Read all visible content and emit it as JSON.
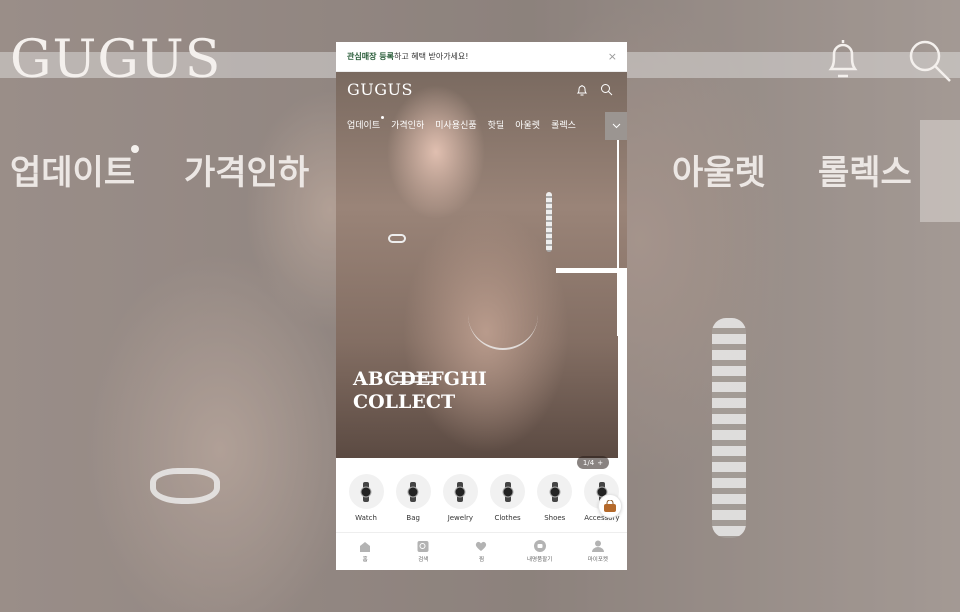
{
  "background": {
    "logo": "GUGUS",
    "nav": [
      "업데이트",
      "가격인하",
      "아울렛",
      "롤렉스"
    ]
  },
  "promo": {
    "highlight": "관심매장 등록",
    "text": "하고 혜택 받아가세요!",
    "close": "×"
  },
  "header": {
    "logo": "GUGUS"
  },
  "nav": {
    "items": [
      "업데이트",
      "가격인하",
      "미사용신품",
      "핫딜",
      "아울렛",
      "롤렉스"
    ]
  },
  "hero": {
    "title_line1": "ABCDEFGHI",
    "title_line2": "COLLECT",
    "subtitle": "구구스가 선택한 주얼리",
    "pager": "1/4",
    "pager_next": "+"
  },
  "categories": [
    {
      "label": "Watch"
    },
    {
      "label": "Bag"
    },
    {
      "label": "Jewelry"
    },
    {
      "label": "Clothes"
    },
    {
      "label": "Shoes"
    },
    {
      "label": "Accessory"
    }
  ],
  "tabbar": {
    "items": [
      {
        "label": "홈",
        "icon": "home-icon"
      },
      {
        "label": "검색",
        "icon": "search-icon"
      },
      {
        "label": "찜",
        "icon": "heart-icon"
      },
      {
        "label": "내명품팔기",
        "icon": "sell-icon"
      },
      {
        "label": "마이포켓",
        "icon": "person-icon"
      }
    ]
  },
  "colors": {
    "promo_highlight": "#2a5d3a",
    "icon_gray": "#b3b3b3"
  }
}
